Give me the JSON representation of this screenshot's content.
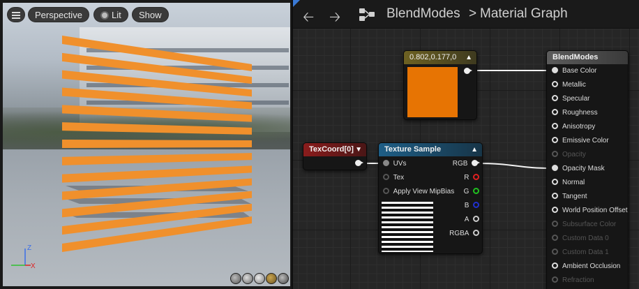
{
  "viewport": {
    "menu_icon": "hamburger-menu-icon",
    "perspective_label": "Perspective",
    "lit_label": "Lit",
    "show_label": "Show",
    "axis_z": "Z",
    "axis_x": "X",
    "colors": {
      "stripe": "#f0902c",
      "axis_x": "#e02020",
      "axis_z": "#3a6ee8",
      "axis_y": "#30c030"
    }
  },
  "toolbar": {
    "back_icon": "arrow-left-icon",
    "forward_icon": "arrow-right-icon",
    "graph_icon": "node-graph-icon",
    "breadcrumb_asset": "BlendModes",
    "breadcrumb_sep": ">",
    "breadcrumb_page": "Material Graph"
  },
  "nodes": {
    "constant": {
      "title": "0.802,0.177,0",
      "color": "#e77403"
    },
    "texcoord": {
      "title": "TexCoord[0]"
    },
    "texture_sample": {
      "title": "Texture Sample",
      "inputs": [
        "UVs",
        "Tex",
        "Apply View MipBias"
      ],
      "outputs": [
        "RGB",
        "R",
        "G",
        "B",
        "A",
        "RGBA"
      ]
    },
    "material": {
      "title": "BlendModes",
      "pins": [
        {
          "label": "Base Color",
          "active": true,
          "connected": true
        },
        {
          "label": "Metallic",
          "active": true,
          "connected": false
        },
        {
          "label": "Specular",
          "active": true,
          "connected": false
        },
        {
          "label": "Roughness",
          "active": true,
          "connected": false
        },
        {
          "label": "Anisotropy",
          "active": true,
          "connected": false
        },
        {
          "label": "Emissive Color",
          "active": true,
          "connected": false
        },
        {
          "label": "Opacity",
          "active": false,
          "connected": false
        },
        {
          "label": "Opacity Mask",
          "active": true,
          "connected": true
        },
        {
          "label": "Normal",
          "active": true,
          "connected": false
        },
        {
          "label": "Tangent",
          "active": true,
          "connected": false
        },
        {
          "label": "World Position Offset",
          "active": true,
          "connected": false
        },
        {
          "label": "Subsurface Color",
          "active": false,
          "connected": false
        },
        {
          "label": "Custom Data 0",
          "active": false,
          "connected": false
        },
        {
          "label": "Custom Data 1",
          "active": false,
          "connected": false
        },
        {
          "label": "Ambient Occlusion",
          "active": true,
          "connected": false
        },
        {
          "label": "Refraction",
          "active": false,
          "connected": false
        }
      ]
    }
  }
}
